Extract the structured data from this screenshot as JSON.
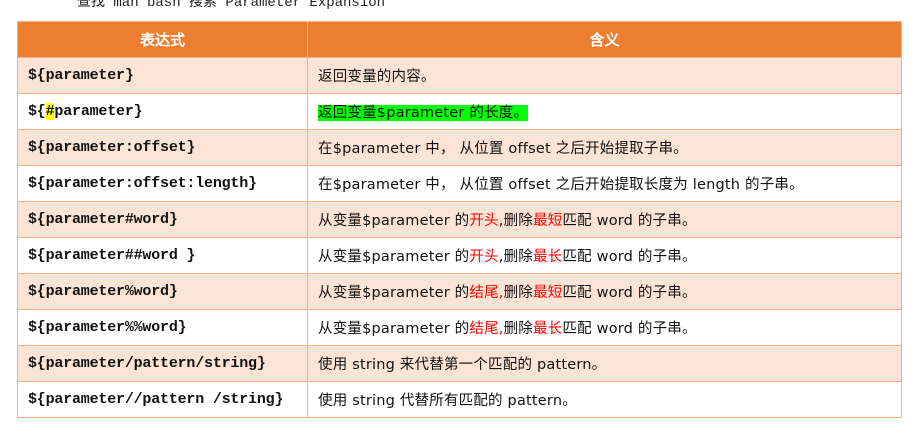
{
  "caption": "查找 man bash 搜索 Parameter Expansion",
  "header": {
    "col_expression": "表达式",
    "col_meaning": "含义"
  },
  "colors": {
    "header_bg": "#ed7d31",
    "odd_row_bg": "#fbe4d5",
    "border": "#f4b183",
    "highlight_yellow": "#ffff00",
    "highlight_green": "#00ff00",
    "emphasis_red": "#ff0000"
  },
  "rows": [
    {
      "expr": "${parameter}",
      "meaning": "返回变量的内容。"
    },
    {
      "expr_a": "${",
      "expr_highlight": "#",
      "expr_b": "parameter}",
      "meaning": "返回变量$parameter 的长度。"
    },
    {
      "expr": "${parameter:offset}",
      "meaning": "在$parameter 中，  从位置 offset 之后开始提取子串。"
    },
    {
      "expr": "${parameter:offset:length}",
      "meaning": "在$parameter 中，  从位置 offset 之后开始提取长度为 length 的子串。"
    },
    {
      "expr": "${parameter#word}",
      "m_a": "从变量$parameter 的",
      "m_red1": "开头",
      "m_b": ",删除",
      "m_red2": "最短",
      "m_c": "匹配 word 的子串。"
    },
    {
      "expr": "${parameter##word }",
      "m_a": "从变量$parameter 的",
      "m_red1": "开头",
      "m_b": ",删除",
      "m_red2": "最长",
      "m_c": "匹配 word 的子串。"
    },
    {
      "expr": "${parameter%word}",
      "m_a": "从变量$parameter 的",
      "m_red1": "结尾,",
      "m_b": "删除",
      "m_red2": "最短",
      "m_c": "匹配 word 的子串。"
    },
    {
      "expr": "${parameter%%word}",
      "m_a": "从变量$parameter 的",
      "m_red1": "结尾,",
      "m_b": "删除",
      "m_red2": "最长",
      "m_c": "匹配 word 的子串。"
    },
    {
      "expr": "${parameter/pattern/string}",
      "meaning": "使用 string 来代替第一个匹配的 pattern。"
    },
    {
      "expr": "${parameter//pattern /string}",
      "meaning": "使用 string 代替所有匹配的 pattern。"
    }
  ]
}
